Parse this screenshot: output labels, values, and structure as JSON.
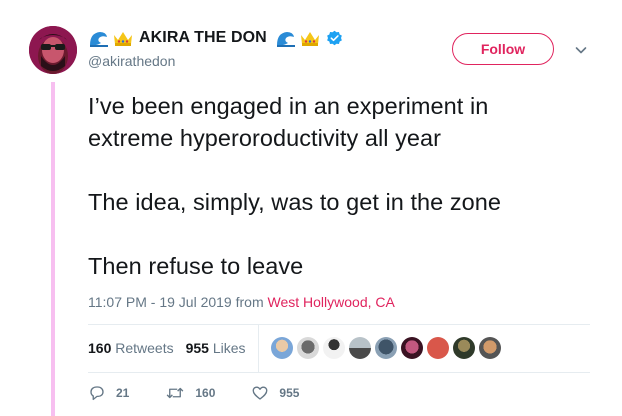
{
  "account": {
    "display_name": "AKIRA THE DON",
    "handle": "@akirathedon",
    "name_emojis": [
      "wave-emoji",
      "crown-emoji"
    ],
    "verified": true
  },
  "follow_button": {
    "label": "Follow"
  },
  "menu": {
    "icon": "chevron-down-icon"
  },
  "tweet": {
    "lines": [
      "I’ve been engaged in an experiment in",
      "extreme hyperoroductivity all year",
      "The idea, simply, was to get in the zone",
      "Then refuse to leave"
    ],
    "time": "11:07 PM - 19 Jul 2019",
    "from_label": "from",
    "location": "West Hollywood, CA"
  },
  "stats": {
    "retweets_count": "160",
    "retweets_label": "Retweets",
    "likes_count": "955",
    "likes_label": "Likes"
  },
  "actions": {
    "replies": "21",
    "retweets": "160",
    "likes": "955"
  },
  "colors": {
    "accent": "#e0245e",
    "thread_line": "#f7bff0",
    "verified_blue": "#1da1f2",
    "secondary_text": "#657786"
  }
}
